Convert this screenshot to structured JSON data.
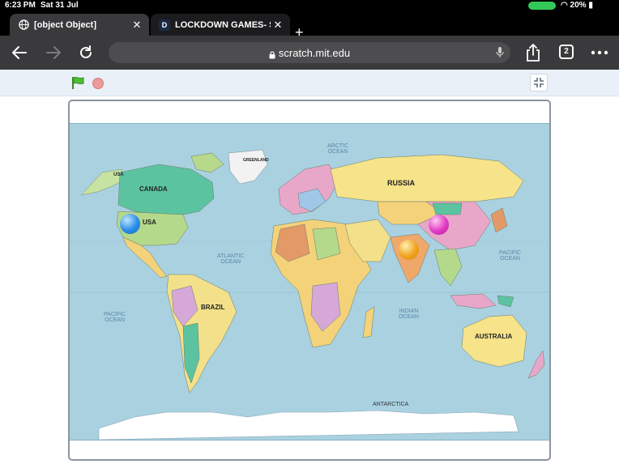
{
  "status": {
    "time": "6:23 PM",
    "date": "Sat 31 Jul",
    "battery": "20%"
  },
  "tabs": [
    {
      "title": "[object Object]",
      "favicon": "globe-icon"
    },
    {
      "title": "LOCKDOWN GAMES- SI",
      "favicon": "D"
    }
  ],
  "nav": {
    "url": "scratch.mit.edu",
    "tab_count": "2"
  },
  "map": {
    "labels": {
      "arctic": "ARCTIC\nOCEAN",
      "atlantic": "ATLANTIC\nOCEAN",
      "pacific_left": "PACIFIC\nOCEAN",
      "pacific_right": "PACIFIC\nOCEAN",
      "indian": "INDIAN\nOCEAN",
      "antarctica": "ANTARCTICA",
      "russia": "RUSSIA",
      "canada": "CANADA",
      "usa_north": "USA",
      "usa": "USA",
      "brazil": "BRAZIL",
      "australia": "AUSTRALIA",
      "greenland": "GREENLAND"
    },
    "balls": [
      {
        "name": "blue",
        "color": "#2a8ce8"
      },
      {
        "name": "orange",
        "color": "#f0a21e"
      },
      {
        "name": "pink",
        "color": "#e03ac4"
      }
    ]
  }
}
